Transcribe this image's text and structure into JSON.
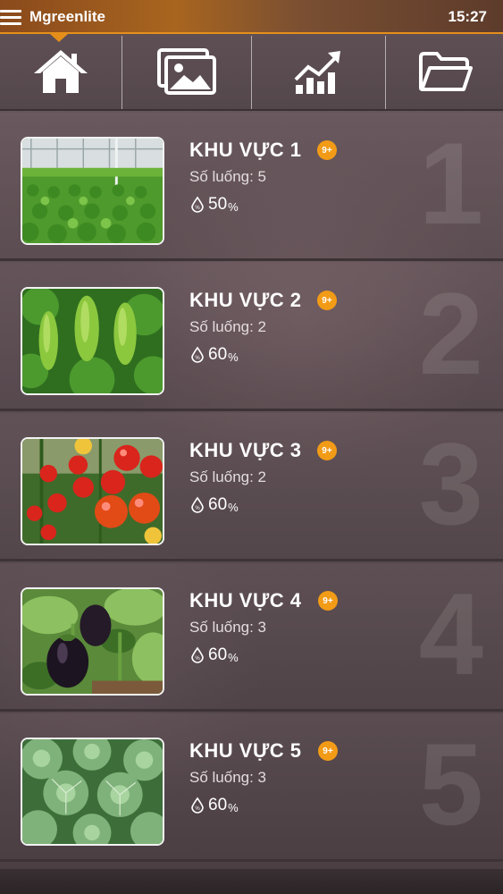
{
  "status_bar": {
    "app_title": "Mgreenlite",
    "time": "15:27"
  },
  "toolbar": {
    "tabs": [
      {
        "icon": "home-icon",
        "active": true
      },
      {
        "icon": "gallery-icon",
        "active": false
      },
      {
        "icon": "chart-growth-icon",
        "active": false
      },
      {
        "icon": "folder-icon",
        "active": false
      }
    ],
    "accent_color": "#e58f1a"
  },
  "zones": [
    {
      "name": "KHU VỰC 1",
      "badge": "9+",
      "beds": "Số luống: 5",
      "humidity_value": "50",
      "humidity_unit": "%",
      "index": "1",
      "image": "lettuce-field"
    },
    {
      "name": "KHU VỰC 2",
      "badge": "9+",
      "beds": "Số luống: 2",
      "humidity_value": "60",
      "humidity_unit": "%",
      "index": "2",
      "image": "bitter-melon"
    },
    {
      "name": "KHU VỰC 3",
      "badge": "9+",
      "beds": "Số luống: 2",
      "humidity_value": "60",
      "humidity_unit": "%",
      "index": "3",
      "image": "tomatoes"
    },
    {
      "name": "KHU VỰC 4",
      "badge": "9+",
      "beds": "Số luống: 3",
      "humidity_value": "60",
      "humidity_unit": "%",
      "index": "4",
      "image": "eggplant"
    },
    {
      "name": "KHU VỰC 5",
      "badge": "9+",
      "beds": "Số luống: 3",
      "humidity_value": "60",
      "humidity_unit": "%",
      "index": "5",
      "image": "cabbage"
    }
  ]
}
